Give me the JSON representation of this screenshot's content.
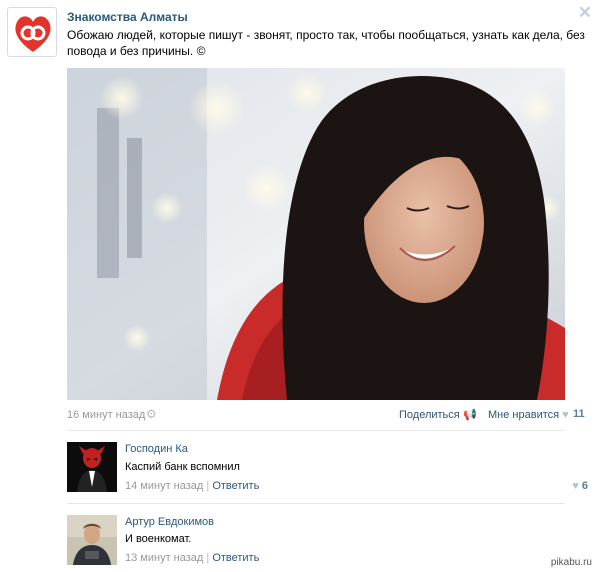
{
  "post": {
    "author": "Знакомства Алматы",
    "text": "Обожаю людей, которые пишут - звонят, просто так, чтобы пообщаться, узнать как дела, без повода и без причины. ©",
    "time": "16 минут назад",
    "share_label": "Поделиться",
    "like_label": "Мне нравится",
    "like_count": "11",
    "close_icon": "close-icon",
    "avatar_icon": "heart-logo"
  },
  "comments": [
    {
      "name": "Господин Ка",
      "text": "Каспий банк вспомнил",
      "time": "14 минут назад",
      "sep": "|",
      "reply": "Ответить",
      "likes": "6"
    },
    {
      "name": "Артур Евдокимов",
      "text": "И военкомат.",
      "time": "13 минут назад",
      "sep": "|",
      "reply": "Ответить"
    }
  ],
  "watermark": "pikabu.ru",
  "colors": {
    "link": "#2b587a",
    "muted": "#999999",
    "like_count": "#5d7c9b",
    "brand_red": "#e2332c"
  }
}
